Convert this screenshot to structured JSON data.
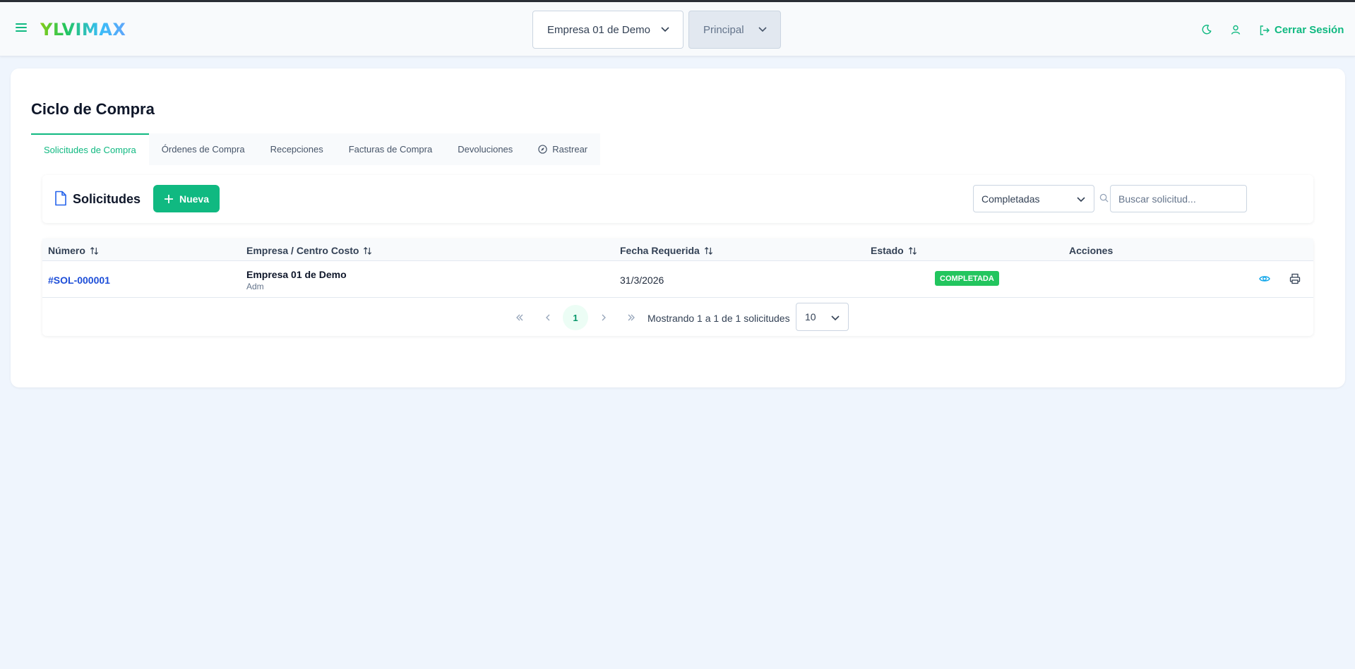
{
  "header": {
    "logo": "YLVIMAX",
    "company_select": {
      "value": "Empresa 01 de Demo"
    },
    "branch_select": {
      "value": "Principal"
    },
    "logout_label": "Cerrar Sesión",
    "icons": [
      "menu-icon",
      "moon-icon",
      "user-icon",
      "logout-icon"
    ]
  },
  "page": {
    "title": "Ciclo de Compra",
    "tabs": [
      {
        "label": "Solicitudes de Compra",
        "active": true
      },
      {
        "label": "Órdenes de Compra"
      },
      {
        "label": "Recepciones"
      },
      {
        "label": "Facturas de Compra"
      },
      {
        "label": "Devoluciones"
      },
      {
        "label": "Rastrear",
        "icon": "compass-icon"
      }
    ]
  },
  "toolbar": {
    "title": "Solicitudes",
    "new_label": "Nueva",
    "filter_value": "Completadas",
    "search_placeholder": "Buscar solicitud..."
  },
  "table": {
    "columns": [
      "Número",
      "Empresa / Centro Costo",
      "Fecha Requerida",
      "Estado",
      "Acciones"
    ],
    "rows": [
      {
        "number": "#SOL-000001",
        "company": "Empresa 01 de Demo",
        "cost_center": "Adm",
        "date": "31/3/2026",
        "status": "COMPLETADA"
      }
    ]
  },
  "pagination": {
    "current_page": "1",
    "summary": "Mostrando 1 a 1 de 1 solicitudes",
    "page_size": "10"
  },
  "colors": {
    "accent": "#10b981",
    "link": "#1d4ed8",
    "badge": "#22c55e",
    "background": "#eff5fd"
  }
}
